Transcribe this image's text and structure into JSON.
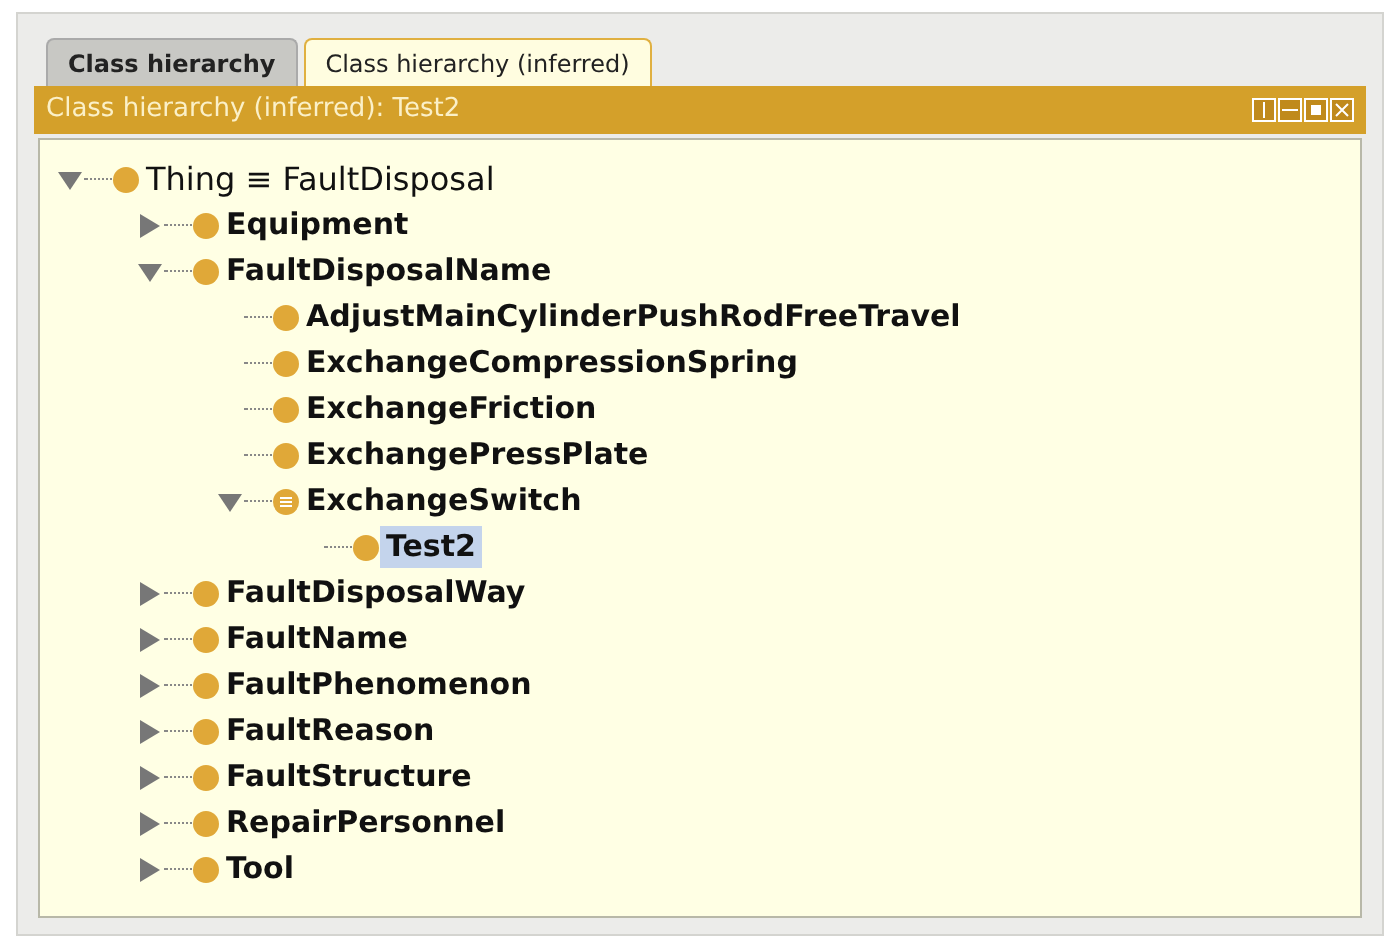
{
  "tabs": [
    {
      "label": "Class hierarchy",
      "selected": false
    },
    {
      "label": "Class hierarchy (inferred)",
      "selected": true
    }
  ],
  "panel": {
    "title": "Class hierarchy (inferred): Test2"
  },
  "tree": [
    {
      "label": "Thing ≡ FaultDisposal",
      "kind": "root",
      "expanded": true,
      "selected": false,
      "children": [
        {
          "label": "Equipment",
          "kind": "class",
          "expanded": false,
          "selected": false
        },
        {
          "label": "FaultDisposalName",
          "kind": "class",
          "expanded": true,
          "selected": false,
          "children": [
            {
              "label": "AdjustMainCylinderPushRodFreeTravel",
              "kind": "class",
              "selected": false
            },
            {
              "label": "ExchangeCompressionSpring",
              "kind": "class",
              "selected": false
            },
            {
              "label": "ExchangeFriction",
              "kind": "class",
              "selected": false
            },
            {
              "label": "ExchangePressPlate",
              "kind": "class",
              "selected": false
            },
            {
              "label": "ExchangeSwitch",
              "kind": "defined",
              "expanded": true,
              "selected": false,
              "children": [
                {
                  "label": "Test2",
                  "kind": "class",
                  "selected": true
                }
              ]
            }
          ]
        },
        {
          "label": "FaultDisposalWay",
          "kind": "class",
          "expanded": false,
          "selected": false
        },
        {
          "label": "FaultName",
          "kind": "class",
          "expanded": false,
          "selected": false
        },
        {
          "label": "FaultPhenomenon",
          "kind": "class",
          "expanded": false,
          "selected": false
        },
        {
          "label": "FaultReason",
          "kind": "class",
          "expanded": false,
          "selected": false
        },
        {
          "label": "FaultStructure",
          "kind": "class",
          "expanded": false,
          "selected": false
        },
        {
          "label": "RepairPersonnel",
          "kind": "class",
          "expanded": false,
          "selected": false
        },
        {
          "label": "Tool",
          "kind": "class",
          "expanded": false,
          "selected": false
        }
      ]
    }
  ]
}
